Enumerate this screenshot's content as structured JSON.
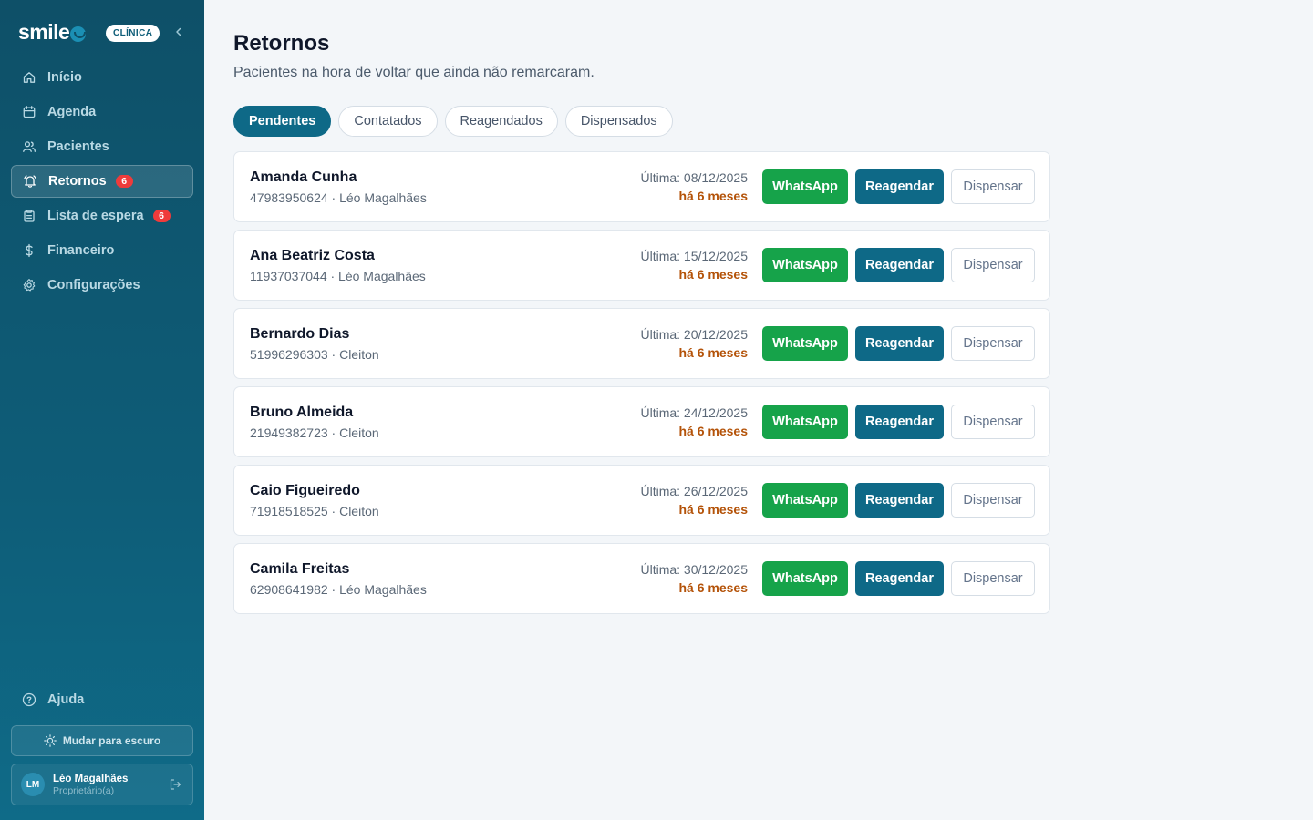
{
  "sidebar": {
    "brand": "smile",
    "clinic_badge": "CLÍNICA",
    "collapse_icon": "chevron-left-icon",
    "items": [
      {
        "label": "Início",
        "icon": "home-icon",
        "active": false
      },
      {
        "label": "Agenda",
        "icon": "calendar-icon",
        "active": false
      },
      {
        "label": "Pacientes",
        "icon": "users-icon",
        "active": false
      },
      {
        "label": "Retornos",
        "icon": "bell-icon",
        "active": true,
        "badge": "6"
      },
      {
        "label": "Lista de espera",
        "icon": "clipboard-icon",
        "active": false,
        "badge": "6"
      },
      {
        "label": "Financeiro",
        "icon": "dollar-icon",
        "active": false
      },
      {
        "label": "Configurações",
        "icon": "gear-icon",
        "active": false
      }
    ],
    "help_label": "Ajuda",
    "theme_label": "Mudar para escuro",
    "user": {
      "initials": "LM",
      "name": "Léo Magalhães",
      "role": "Proprietário(a)"
    }
  },
  "main": {
    "title": "Retornos",
    "subtitle": "Pacientes na hora de voltar que ainda não remarcaram.",
    "tabs": [
      {
        "label": "Pendentes",
        "active": true
      },
      {
        "label": "Contatados",
        "active": false
      },
      {
        "label": "Reagendados",
        "active": false
      },
      {
        "label": "Dispensados",
        "active": false
      }
    ],
    "actions": {
      "whatsapp": "WhatsApp",
      "reschedule": "Reagendar",
      "dismiss": "Dispensar"
    },
    "patients": [
      {
        "name": "Amanda Cunha",
        "meta": "47983950624 · Léo Magalhães",
        "last": "Última: 08/12/2025",
        "ago": "há 6 meses"
      },
      {
        "name": "Ana Beatriz Costa",
        "meta": "11937037044 · Léo Magalhães",
        "last": "Última: 15/12/2025",
        "ago": "há 6 meses"
      },
      {
        "name": "Bernardo Dias",
        "meta": "51996296303 · Cleiton",
        "last": "Última: 20/12/2025",
        "ago": "há 6 meses"
      },
      {
        "name": "Bruno Almeida",
        "meta": "21949382723 · Cleiton",
        "last": "Última: 24/12/2025",
        "ago": "há 6 meses"
      },
      {
        "name": "Caio Figueiredo",
        "meta": "71918518525 · Cleiton",
        "last": "Última: 26/12/2025",
        "ago": "há 6 meses"
      },
      {
        "name": "Camila Freitas",
        "meta": "62908641982 · Léo Magalhães",
        "last": "Última: 30/12/2025",
        "ago": "há 6 meses"
      }
    ]
  },
  "colors": {
    "sidebar": "#0e5d78",
    "accent": "#0e6987",
    "whatsapp": "#16a34a",
    "badge": "#ef3b3b",
    "overdue": "#b45309"
  }
}
